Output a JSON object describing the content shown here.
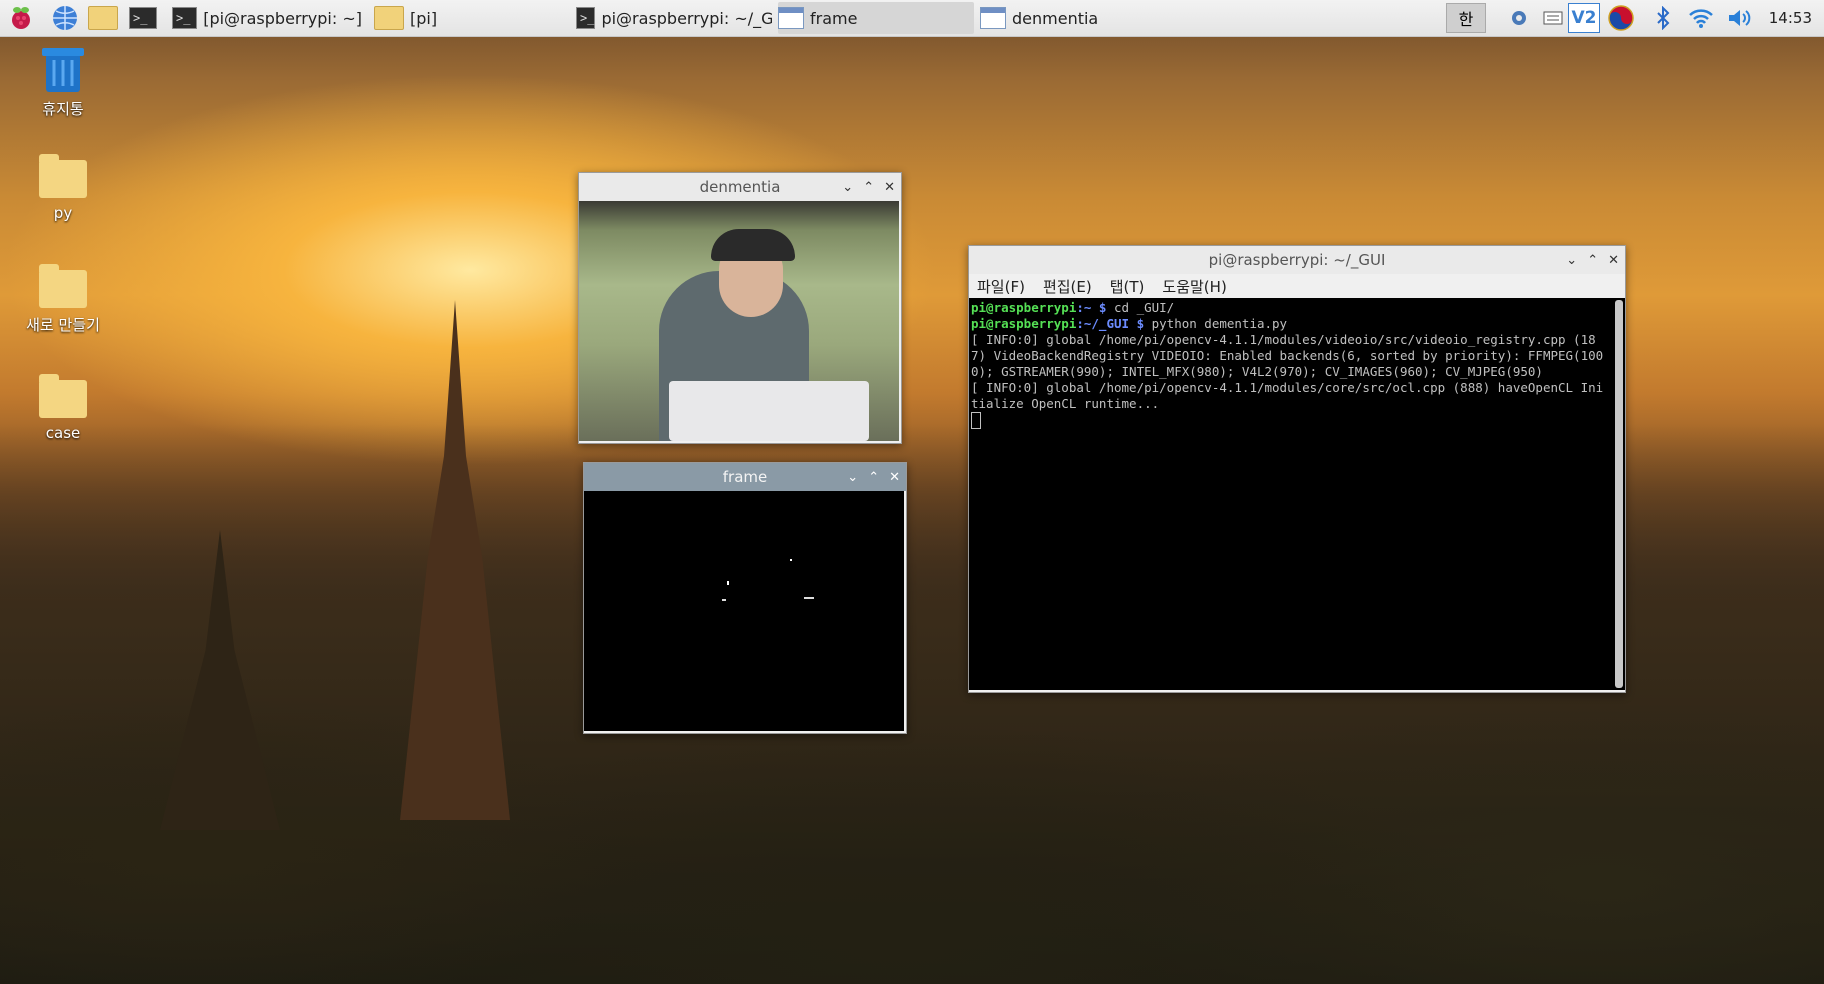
{
  "taskbar": {
    "tasks": [
      {
        "label": "[pi@raspberrypi: ~]",
        "icon": "terminal-icon"
      },
      {
        "label": "[pi]",
        "icon": "folder-icon"
      },
      {
        "label": "pi@raspberrypi: ~/_G...",
        "icon": "terminal-icon"
      },
      {
        "label": "frame",
        "icon": "window-icon"
      },
      {
        "label": "denmentia",
        "icon": "window-icon"
      }
    ],
    "ime": "한",
    "vnc": "V2",
    "clock": "14:53"
  },
  "desktop": {
    "icons": [
      {
        "label": "휴지통",
        "icon": "trash-icon"
      },
      {
        "label": "py",
        "icon": "folder-icon"
      },
      {
        "label": "새로 만들기",
        "icon": "folder-icon"
      },
      {
        "label": "case",
        "icon": "folder-icon"
      }
    ]
  },
  "windows": {
    "denmentia": {
      "title": "denmentia"
    },
    "frame": {
      "title": "frame"
    },
    "terminal": {
      "title": "pi@raspberrypi: ~/_GUI",
      "menu": [
        "파일(F)",
        "편집(E)",
        "탭(T)",
        "도움말(H)"
      ],
      "lines": [
        {
          "prompt_user": "pi@raspberrypi",
          "prompt_path": ":~ $",
          "cmd": " cd _GUI/"
        },
        {
          "prompt_user": "pi@raspberrypi",
          "prompt_path": ":~/_GUI $",
          "cmd": " python dementia.py"
        }
      ],
      "output": [
        "[ INFO:0] global /home/pi/opencv-4.1.1/modules/videoio/src/videoio_registry.cpp (187) VideoBackendRegistry VIDEOIO: Enabled backends(6, sorted by priority): FFMPEG(1000); GSTREAMER(990); INTEL_MFX(980); V4L2(970); CV_IMAGES(960); CV_MJPEG(950)",
        "[ INFO:0] global /home/pi/opencv-4.1.1/modules/core/src/ocl.cpp (888) haveOpenCL Initialize OpenCL runtime..."
      ]
    }
  },
  "colors": {
    "titlebar_inactive": "#eaeaea",
    "titlebar_active": "#8a9aa6",
    "prompt_green": "#55e055",
    "prompt_blue": "#6c8cff"
  }
}
